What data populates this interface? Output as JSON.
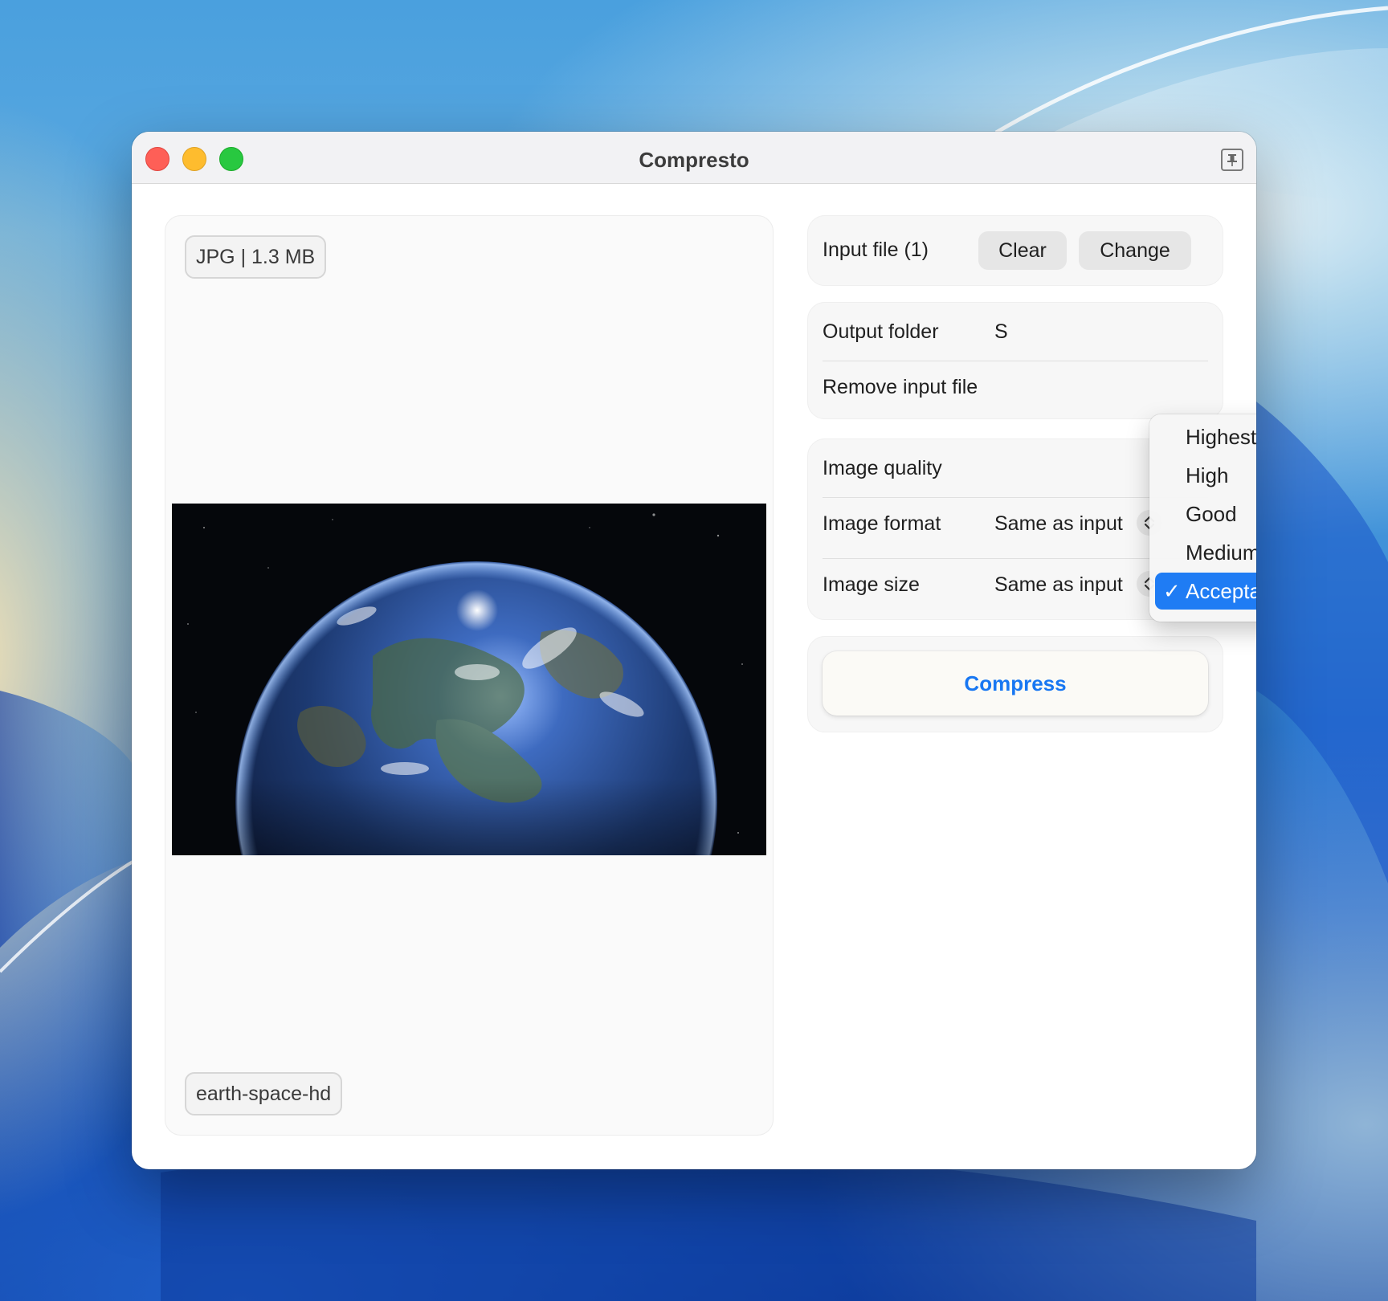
{
  "window": {
    "title": "Compresto"
  },
  "preview": {
    "file_meta": "JPG | 1.3 MB",
    "file_name": "earth-space-hd"
  },
  "input_file": {
    "label": "Input file (1)",
    "clear_label": "Clear",
    "change_label": "Change"
  },
  "output": {
    "folder_label": "Output folder",
    "folder_value_partial": "S",
    "remove_input_label": "Remove input file"
  },
  "image_settings": {
    "quality_label": "Image quality",
    "format_label": "Image format",
    "format_value": "Same as input",
    "size_label": "Image size",
    "size_value": "Same as input"
  },
  "quality_menu": {
    "options": [
      "Highest",
      "High",
      "Good",
      "Medium",
      "Acceptable"
    ],
    "selected": "Acceptable",
    "check_glyph": "✓"
  },
  "actions": {
    "compress_label": "Compress"
  },
  "colors": {
    "accent": "#1f7cf4",
    "compress_text": "#1877f2",
    "close": "#fe5f57",
    "minimize": "#febc2e",
    "maximize": "#28c840"
  },
  "icons": {
    "pin": "pin-icon",
    "stepper": "chevron-up-down-icon"
  }
}
